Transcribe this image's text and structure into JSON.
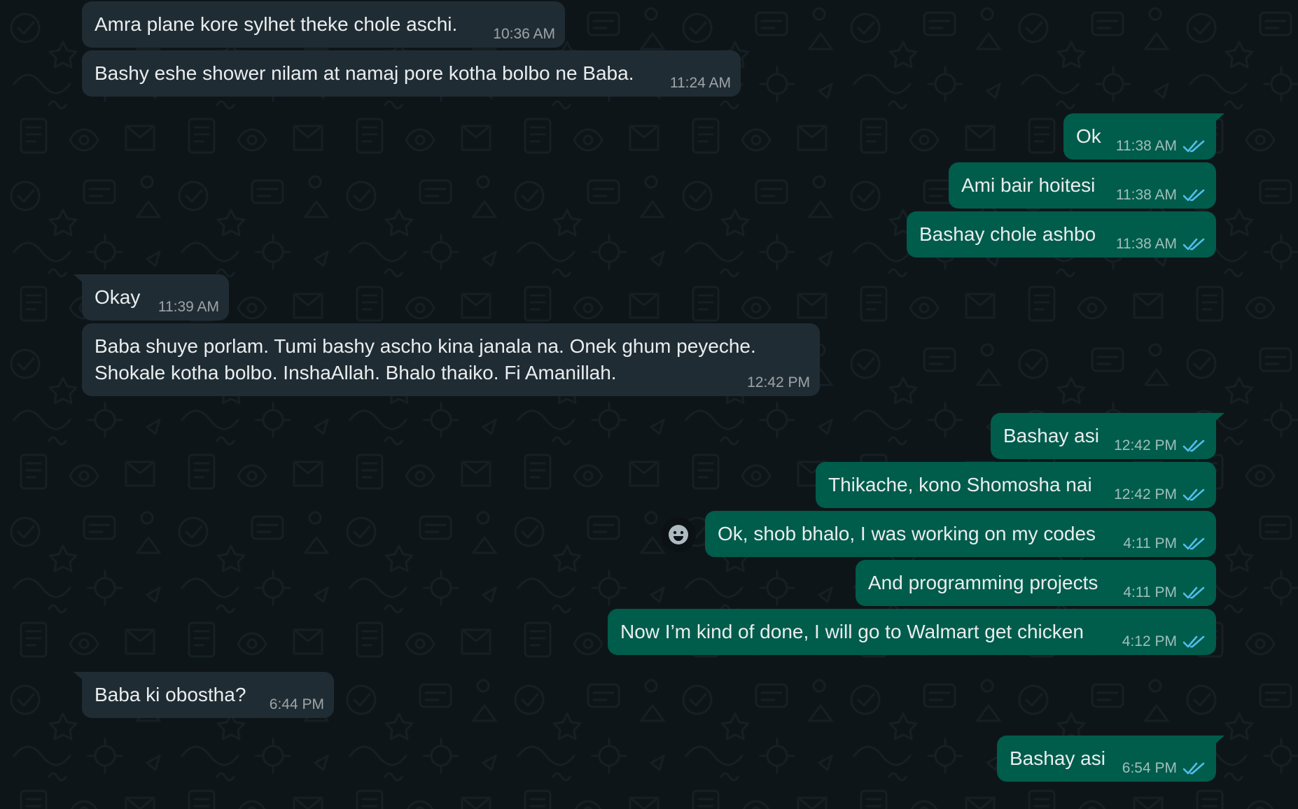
{
  "colors": {
    "background": "#0e1518",
    "incoming_bubble": "#202c33",
    "outgoing_bubble": "#005c4b",
    "text": "#e9edef",
    "read_ticks": "#53bdeb"
  },
  "messages": [
    {
      "direction": "incoming",
      "text": "Amra plane kore sylhet theke chole aschi.",
      "time": "10:36 AM"
    },
    {
      "direction": "incoming",
      "text": "Bashy eshe shower nilam at namaj pore kotha bolbo ne Baba.",
      "time": "11:24 AM"
    },
    {
      "direction": "outgoing",
      "text": "Ok",
      "time": "11:38 AM",
      "status": "read"
    },
    {
      "direction": "outgoing",
      "text": "Ami bair hoitesi",
      "time": "11:38 AM",
      "status": "read"
    },
    {
      "direction": "outgoing",
      "text": "Bashay chole ashbo",
      "time": "11:38 AM",
      "status": "read"
    },
    {
      "direction": "incoming",
      "text": "Okay",
      "time": "11:39 AM"
    },
    {
      "direction": "incoming",
      "text_line1": "Baba shuye porlam. Tumi bashy ascho kina janala na. Onek ghum peyeche.",
      "text_line2": "Shokale kotha bolbo. InshaAllah. Bhalo thaiko. Fi Amanillah.",
      "time": "12:42 PM"
    },
    {
      "direction": "outgoing",
      "text": "Bashay asi",
      "time": "12:42 PM",
      "status": "read"
    },
    {
      "direction": "outgoing",
      "text": "Thikache, kono Shomosha nai",
      "time": "12:42 PM",
      "status": "read"
    },
    {
      "direction": "outgoing",
      "text": "Ok, shob bhalo, I was working on my codes",
      "time": "4:11 PM",
      "status": "read"
    },
    {
      "direction": "outgoing",
      "text": "And programming projects",
      "time": "4:11 PM",
      "status": "read"
    },
    {
      "direction": "outgoing",
      "text": "Now I’m kind of done, I will go to Walmart get chicken",
      "time": "4:12 PM",
      "status": "read"
    },
    {
      "direction": "incoming",
      "text": "Baba ki obostha?",
      "time": "6:44 PM"
    },
    {
      "direction": "outgoing",
      "text": "Bashay asi",
      "time": "6:54 PM",
      "status": "read"
    }
  ],
  "icons": {
    "read_receipt": "double-check-icon",
    "reaction": "smiley-icon"
  }
}
